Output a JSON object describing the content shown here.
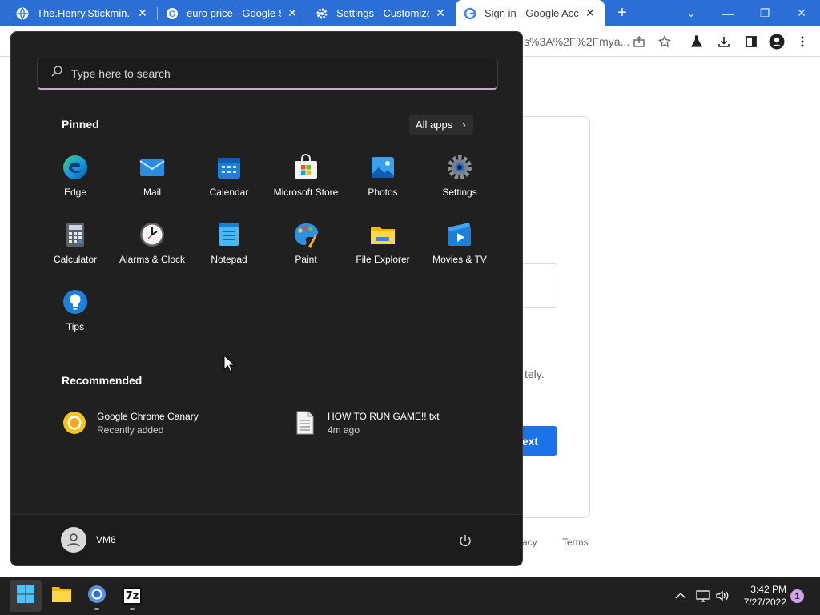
{
  "browser": {
    "tabs": [
      {
        "title": "The.Henry.Stickmin.Col",
        "favicon": "globe-icon"
      },
      {
        "title": "euro price - Google Se",
        "favicon": "google-g-icon"
      },
      {
        "title": "Settings - Customize p",
        "favicon": "gear-icon"
      },
      {
        "title": "Sign in - Google Accou",
        "favicon": "google-g-icon",
        "active": true
      }
    ],
    "url_fragment": "s%3A%2F%2Fmya...",
    "page": {
      "text_fragment": "tely.",
      "next_button": "ext",
      "footer_privacy": "acy",
      "footer_terms": "Terms"
    }
  },
  "start_menu": {
    "search_placeholder": "Type here to search",
    "pinned_title": "Pinned",
    "all_apps_label": "All apps",
    "pinned_apps": [
      {
        "label": "Edge",
        "icon": "edge-icon"
      },
      {
        "label": "Mail",
        "icon": "mail-icon"
      },
      {
        "label": "Calendar",
        "icon": "calendar-icon"
      },
      {
        "label": "Microsoft Store",
        "icon": "store-icon"
      },
      {
        "label": "Photos",
        "icon": "photos-icon"
      },
      {
        "label": "Settings",
        "icon": "settings-gear-icon"
      },
      {
        "label": "Calculator",
        "icon": "calculator-icon"
      },
      {
        "label": "Alarms & Clock",
        "icon": "clock-icon"
      },
      {
        "label": "Notepad",
        "icon": "notepad-icon"
      },
      {
        "label": "Paint",
        "icon": "paint-icon"
      },
      {
        "label": "File Explorer",
        "icon": "folder-icon"
      },
      {
        "label": "Movies & TV",
        "icon": "movies-icon"
      },
      {
        "label": "Tips",
        "icon": "tips-bulb-icon"
      }
    ],
    "recommended_title": "Recommended",
    "recommended": [
      {
        "name": "Google Chrome Canary",
        "sub": "Recently added",
        "icon": "chrome-canary-icon"
      },
      {
        "name": "HOW TO RUN GAME!!.txt",
        "sub": "4m ago",
        "icon": "text-file-icon"
      }
    ],
    "user_name": "VM6"
  },
  "taskbar": {
    "apps": [
      "windows-start-icon",
      "file-explorer-icon",
      "chrome-icon",
      "7zip-icon"
    ],
    "seven_zip_label": "7z",
    "time": "3:42 PM",
    "date": "7/27/2022",
    "notification_count": "1"
  },
  "colors": {
    "chrome_tab_strip": "#2b6fd6",
    "start_bg": "#202020",
    "taskbar_bg": "#202020",
    "accent_blue": "#1a73e8"
  }
}
